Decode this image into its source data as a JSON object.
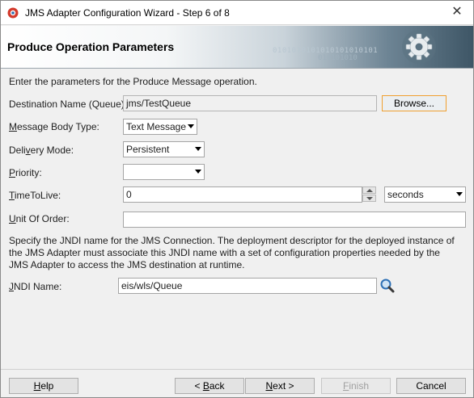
{
  "window": {
    "title": "JMS Adapter Configuration Wizard - Step 6 of 8",
    "close_glyph": "✕"
  },
  "banner": {
    "title": "Produce Operation Parameters",
    "binary_a": "0101010101010101010101",
    "binary_b": "010101010"
  },
  "intro": "Enter the parameters for the Produce Message operation.",
  "form": {
    "destination": {
      "label_pre": "Destination Name (Queue):",
      "value": "jms/TestQueue",
      "browse": "Browse..."
    },
    "message_body_type": {
      "label_m": "M",
      "label_rest": "essage Body Type:",
      "value": "Text Message"
    },
    "delivery_mode": {
      "label_pre": "Deli",
      "label_v": "v",
      "label_rest": "ery Mode:",
      "value": "Persistent"
    },
    "priority": {
      "label_p": "P",
      "label_rest": "riority:",
      "value": ""
    },
    "time_to_live": {
      "label_t": "T",
      "label_rest": "imeToLive:",
      "value": "0",
      "unit": "seconds"
    },
    "unit_of_order": {
      "label_u": "U",
      "label_rest": "nit Of Order:",
      "value": ""
    }
  },
  "jndi_description": "Specify the JNDI name for the JMS Connection.  The deployment descriptor for the deployed instance of the JMS Adapter must associate this JNDI name with a set of configuration properties needed by the JMS Adapter to access the JMS destination at runtime.",
  "jndi": {
    "label_j": "J",
    "label_rest": "NDI Name:",
    "value": "eis/wls/Queue"
  },
  "footer": {
    "help_h": "H",
    "help_rest": "elp",
    "back_pre": "< ",
    "back_b": "B",
    "back_rest": "ack",
    "next_n": "N",
    "next_rest": "ext >",
    "finish_f": "F",
    "finish_rest": "inish",
    "cancel": "Cancel"
  },
  "colors": {
    "accent_focus": "#f0a030",
    "banner_dark": "#3e5666"
  },
  "icons": {
    "app": "jdeveloper-icon",
    "gear": "gear-icon",
    "search": "search-icon"
  }
}
